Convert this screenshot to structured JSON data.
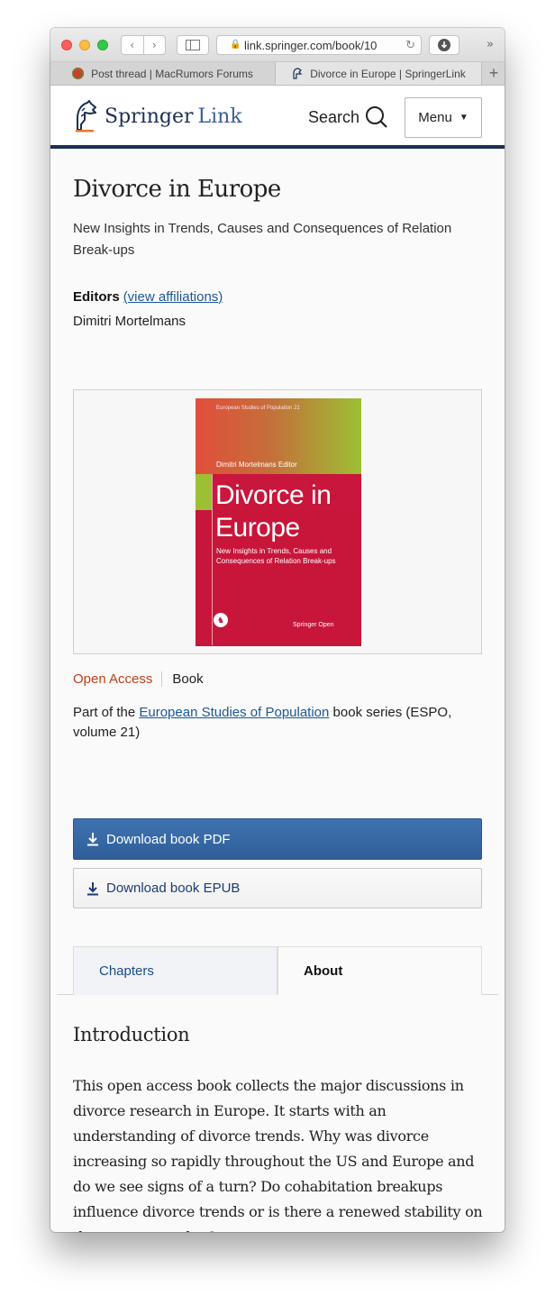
{
  "browser": {
    "address": "link.springer.com/book/10",
    "tabs": [
      {
        "label": "Post thread | MacRumors Forums"
      },
      {
        "label": "Divorce in Europe | SpringerLink"
      }
    ],
    "overflow_label": "»",
    "new_tab_label": "+"
  },
  "header": {
    "brand_main": "Springer",
    "brand_secondary": "Link",
    "search_label": "Search",
    "menu_label": "Menu"
  },
  "book": {
    "title": "Divorce in Europe",
    "subtitle": "New Insights in Trends, Causes and Consequences of Relation Break-ups",
    "editors_label": "Editors",
    "affiliations_link": "(view affiliations)",
    "editor_name": "Dimitri Mortelmans",
    "access": "Open Access",
    "type": "Book",
    "series_prefix": "Part of the ",
    "series_link": "European Studies of Population",
    "series_suffix": " book series (ESPO, volume 21)"
  },
  "cover": {
    "series_line": "European Studies of Population   21",
    "editor_line": "Dimitri Mortelmans  Editor",
    "title_line1": "Divorce in",
    "title_line2": "Europe",
    "subtitle": "New Insights in Trends, Causes and Consequences of Relation Break-ups",
    "publisher": "Springer Open"
  },
  "downloads": {
    "pdf_label": "Download book PDF",
    "epub_label": "Download book EPUB"
  },
  "page_tabs": {
    "chapters": "Chapters",
    "about": "About"
  },
  "intro": {
    "heading": "Introduction",
    "text": "This open access book collects the major discussions in divorce research in Europe.  It starts with an understanding of divorce trends. Why was divorce increasing so rapidly throughout the US and Europe and do we see signs of a turn? Do cohabitation breakups influence divorce trends or is there a renewed stability on the partner market?"
  },
  "colors": {
    "brand_navy": "#1b3051",
    "link_blue": "#1b5896",
    "open_access": "#c0401a",
    "pdf_button": "#3569a5",
    "cover_red": "#c8153a",
    "cover_green": "#9cbf33"
  },
  "icons": [
    "lock-icon",
    "reload-icon",
    "download-icon",
    "sidebar-icon",
    "search-icon",
    "springer-horse-icon",
    "menu-caret-icon",
    "download-arrow-icon"
  ]
}
